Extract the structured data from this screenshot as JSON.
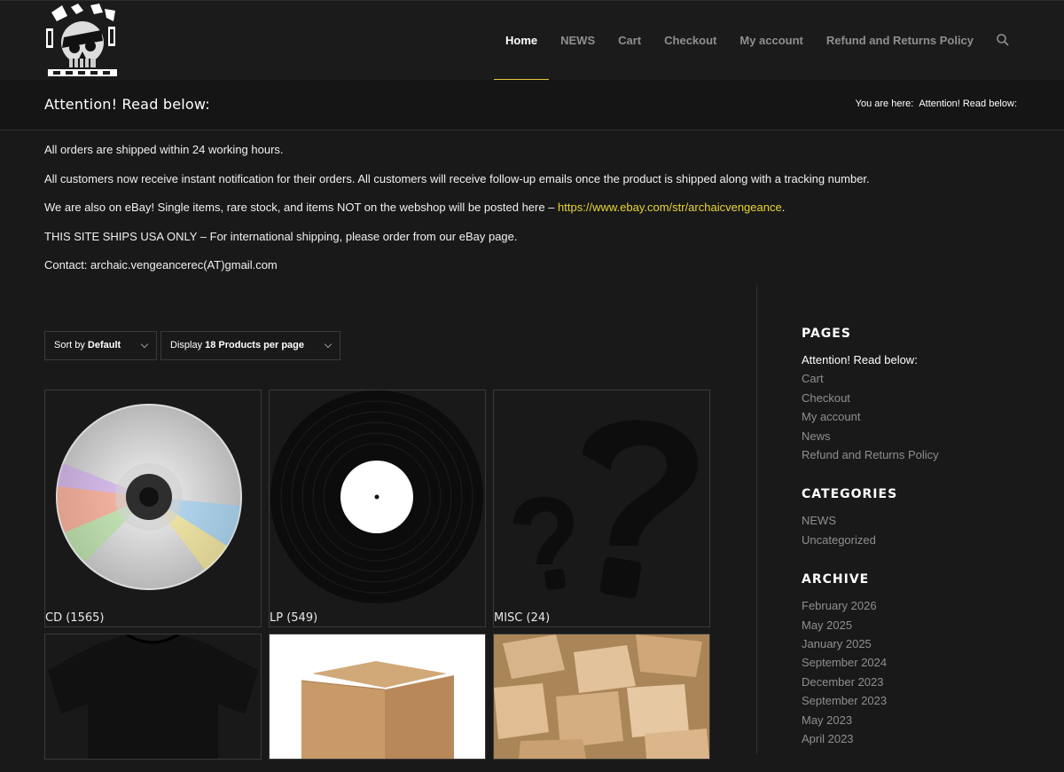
{
  "header": {
    "nav": [
      {
        "label": "Home",
        "active": true
      },
      {
        "label": "NEWS"
      },
      {
        "label": "Cart"
      },
      {
        "label": "Checkout"
      },
      {
        "label": "My account"
      },
      {
        "label": "Refund and Returns Policy"
      }
    ],
    "icons": {
      "logo": "skull-logo-icon",
      "search": "search-icon"
    }
  },
  "titlebar": {
    "title": "Attention! Read below:",
    "breadcrumb_prefix": "You are here:",
    "breadcrumb_current": "Attention! Read below:"
  },
  "notices": {
    "line1": "All orders are shipped within 24 working hours.",
    "line2": "All customers now receive instant notification for their orders. All customers will receive follow-up emails once the product is shipped along with a tracking number.",
    "line3_text": "We are also on eBay! Single items, rare stock, and items NOT on the webshop will be posted here – ",
    "line3_link": "https://www.ebay.com/str/archaicvengeance",
    "line3_end": ".",
    "line4": "THIS SITE SHIPS USA ONLY – For international shipping, please order from our eBay page.",
    "line5": "Contact: archaic.vengeancerec(AT)gmail.com"
  },
  "sort": {
    "sort_prefix": "Sort by ",
    "sort_value": "Default",
    "display_prefix": "Display ",
    "display_value": "18 Products per page"
  },
  "products": [
    {
      "caption": "CD (1565)",
      "image": "cd-disc-icon"
    },
    {
      "caption": "LP (549)",
      "image": "vinyl-record-icon"
    },
    {
      "caption": "MISC (24)",
      "image": "question-mark-icon"
    },
    {
      "caption": "",
      "image": "tshirt-icon"
    },
    {
      "caption": "",
      "image": "cardboard-box-icon"
    },
    {
      "caption": "",
      "image": "cardboard-boxes-pile-icon"
    }
  ],
  "sidebar": {
    "pages_title": "PAGES",
    "pages": [
      "Attention! Read below:",
      "Cart",
      "Checkout",
      "My account",
      "News",
      "Refund and Returns Policy"
    ],
    "categories_title": "CATEGORIES",
    "categories": [
      "NEWS",
      "Uncategorized"
    ],
    "archive_title": "ARCHIVE",
    "archive": [
      "February 2026",
      "May 2025",
      "January 2025",
      "September 2024",
      "December 2023",
      "September 2023",
      "May 2023",
      "April 2023"
    ]
  },
  "colors": {
    "accent": "#e5c53a",
    "link": "#e8d534",
    "background": "#191919"
  }
}
